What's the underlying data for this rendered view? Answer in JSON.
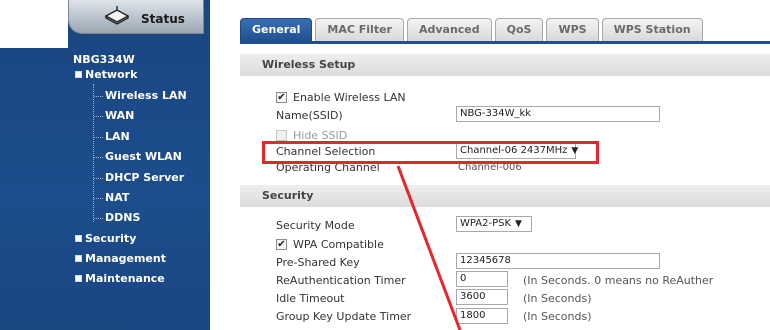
{
  "status_tab": {
    "label": "Status",
    "icon": "status-icon"
  },
  "sidebar": {
    "device_name": "NBG334W",
    "network": {
      "label": "Network",
      "items": [
        "Wireless LAN",
        "WAN",
        "LAN",
        "Guest WLAN",
        "DHCP Server",
        "NAT",
        "DDNS"
      ]
    },
    "groups": [
      "Security",
      "Management",
      "Maintenance"
    ]
  },
  "tabs": [
    "General",
    "MAC Filter",
    "Advanced",
    "QoS",
    "WPS",
    "WPS Station"
  ],
  "active_tab": "General",
  "wireless_setup": {
    "header": "Wireless Setup",
    "enable_label": "Enable Wireless LAN",
    "enable_checked": true,
    "ssid_label": "Name(SSID)",
    "ssid_value": "NBG-334W_kk",
    "hide_ssid_label": "Hide SSID",
    "channel_label": "Channel Selection",
    "channel_value": "Channel-06 2437MHz",
    "operating_label": "Operating Channel",
    "operating_value": "Channel-006"
  },
  "security": {
    "header": "Security",
    "mode_label": "Security Mode",
    "mode_value": "WPA2-PSK",
    "wpa_compat_label": "WPA Compatible",
    "wpa_compat_checked": true,
    "psk_label": "Pre-Shared Key",
    "psk_value": "12345678",
    "reauth_label": "ReAuthentication Timer",
    "reauth_value": "0",
    "reauth_note": "(In Seconds. 0 means no ReAuther",
    "idle_label": "Idle Timeout",
    "idle_value": "3600",
    "idle_note": "(In Seconds)",
    "group_key_label": "Group Key Update Timer",
    "group_key_value": "1800",
    "group_key_note": "(In Seconds)"
  },
  "colors": {
    "sidebar": "#1c4a86",
    "highlight": "#e5262c",
    "tab_active": "#1f4f91"
  }
}
